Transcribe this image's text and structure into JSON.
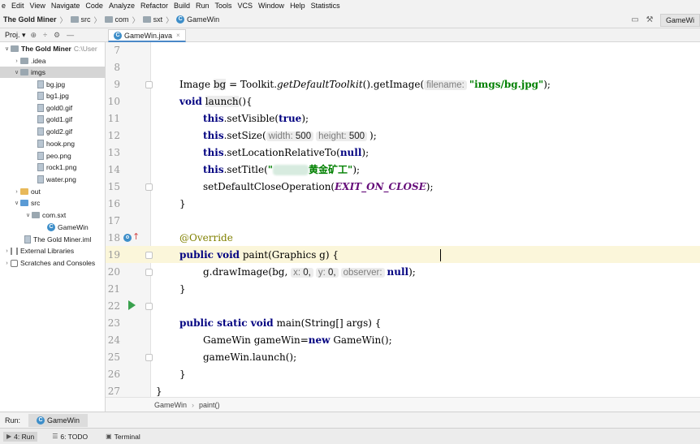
{
  "menu": [
    "e",
    "Edit",
    "View",
    "Navigate",
    "Code",
    "Analyze",
    "Refactor",
    "Build",
    "Run",
    "Tools",
    "VCS",
    "Window",
    "Help",
    "Statistics"
  ],
  "nav": {
    "project": "The Gold Miner",
    "crumbs": [
      "src",
      "com",
      "sxt",
      "GameWin"
    ],
    "run_config": "GameWi"
  },
  "project_panel": {
    "title": "Proj.",
    "root_name": "The Gold Miner",
    "root_path": "C:\\User",
    "tree": {
      "idea": ".idea",
      "imgs": "imgs",
      "files": [
        "bg.jpg",
        "bg1.jpg",
        "gold0.gif",
        "gold1.gif",
        "gold2.gif",
        "hook.png",
        "peo.png",
        "rock1.png",
        "water.png"
      ],
      "out": "out",
      "src": "src",
      "pkg": "com.sxt",
      "cls": "GameWin",
      "iml": "The Gold Miner.iml",
      "ext": "External Libraries",
      "scratch": "Scratches and Consoles"
    }
  },
  "editor": {
    "tab_label": "GameWin.java",
    "line_numbers": [
      "7",
      "8",
      "9",
      "10",
      "11",
      "12",
      "13",
      "14",
      "15",
      "16",
      "17",
      "18",
      "19",
      "20",
      "21",
      "22",
      "23",
      "24",
      "25",
      "26",
      "27"
    ],
    "code": {
      "l8_a": "Image ",
      "l8_b": "bg",
      "l8_c": " = Toolkit.",
      "l8_d": "getDefaultToolkit",
      "l8_e": "().getImage(",
      "l8_hint": "filename:",
      "l8_str": "\"imgs/bg.jpg\"",
      "l8_f": ");",
      "l9_kw": "void",
      "l9_name": "launch",
      "l9_rest": "(){",
      "kw_this": "this",
      "l10_a": ".setVisible(",
      "l10_kw": "true",
      "l10_b": ");",
      "l11_a": ".setSize(",
      "l11_h1": "width:",
      "l11_v1": "500",
      "l11_h2": "height:",
      "l11_v2": "500",
      "l11_b": ");",
      "l12_a": ".setLocationRelativeTo(",
      "l12_kw": "null",
      "l12_b": ");",
      "l13_a": ".setTitle(",
      "l13_q": "\"",
      "l13_title": "黄金矿工\"",
      "l13_b": ");",
      "l14_a": "setDefaultCloseOperation(",
      "l14_const": "EXIT_ON_CLOSE",
      "l14_b": ");",
      "brace_close": "}",
      "l17_ann": "@Override",
      "l18_kw": "public void",
      "l18_rest": " paint(Graphics g) {",
      "l19_a": "g.drawImage(bg,",
      "l19_hx": "x:",
      "l19_vx": "0,",
      "l19_hy": "y:",
      "l19_vy": "0,",
      "l19_ho": "observer:",
      "l19_kw": "null",
      "l19_b": ");",
      "l22_kw": "public static void",
      "l22_rest": " main(String[] args) {",
      "l23_a": "GameWin gameWin=",
      "l23_kw": "new",
      "l23_b": " GameWin();",
      "l24": "gameWin.launch();",
      "l26": "}"
    },
    "breadcrumb": [
      "GameWin",
      "paint()"
    ]
  },
  "run_panel": {
    "label": "Run:",
    "tab": "GameWin"
  },
  "tool_windows": [
    "4: Run",
    "6: TODO",
    "Terminal"
  ],
  "colors": {
    "keyword": "#000080",
    "string": "#008000",
    "annotation": "#808000",
    "constant": "#660e7a",
    "current_line": "#fbf6da",
    "run_gutter": "#39a14d"
  }
}
